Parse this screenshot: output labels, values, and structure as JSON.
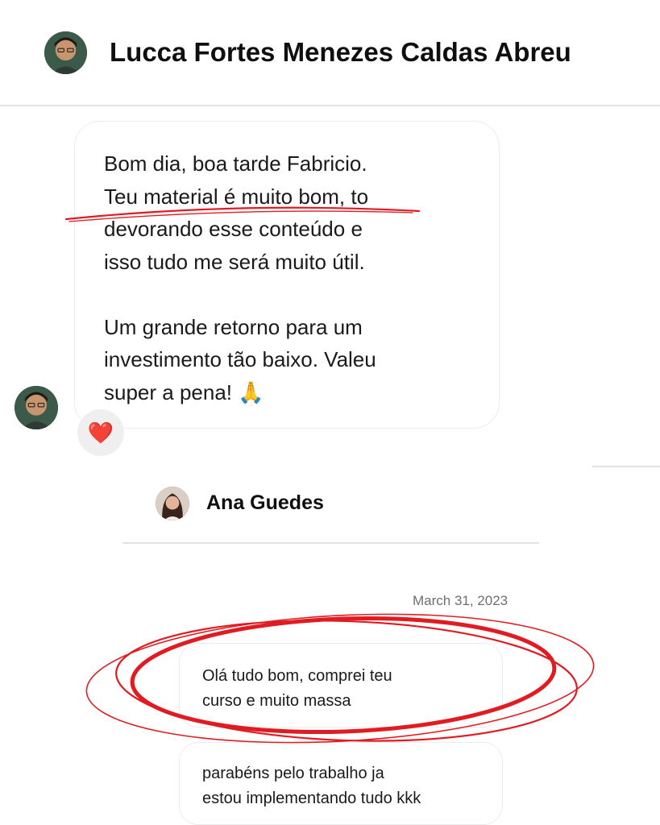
{
  "chat1": {
    "contact_name": "Lucca Fortes Menezes Caldas Abreu",
    "message": "Bom dia, boa tarde Fabricio.\nTeu material é muito bom, to\ndevorando esse conteúdo e\nisso tudo me será muito útil.\n\nUm grande retorno para um\ninvestimento tão baixo. Valeu\nsuper a pena! 🙏",
    "reaction": "❤️"
  },
  "chat2": {
    "contact_name": "Ana Guedes",
    "date": "March 31, 2023",
    "messages": [
      {
        "text": "Olá tudo bom, comprei teu\ncurso e muito massa"
      },
      {
        "text": "parabéns pelo trabalho ja\nestou implementando tudo kkk"
      }
    ]
  },
  "colors": {
    "annotation": "#e11b22",
    "divider": "#e3e3e3",
    "bubble_border": "#ececec",
    "reaction_bg": "#efefef"
  }
}
